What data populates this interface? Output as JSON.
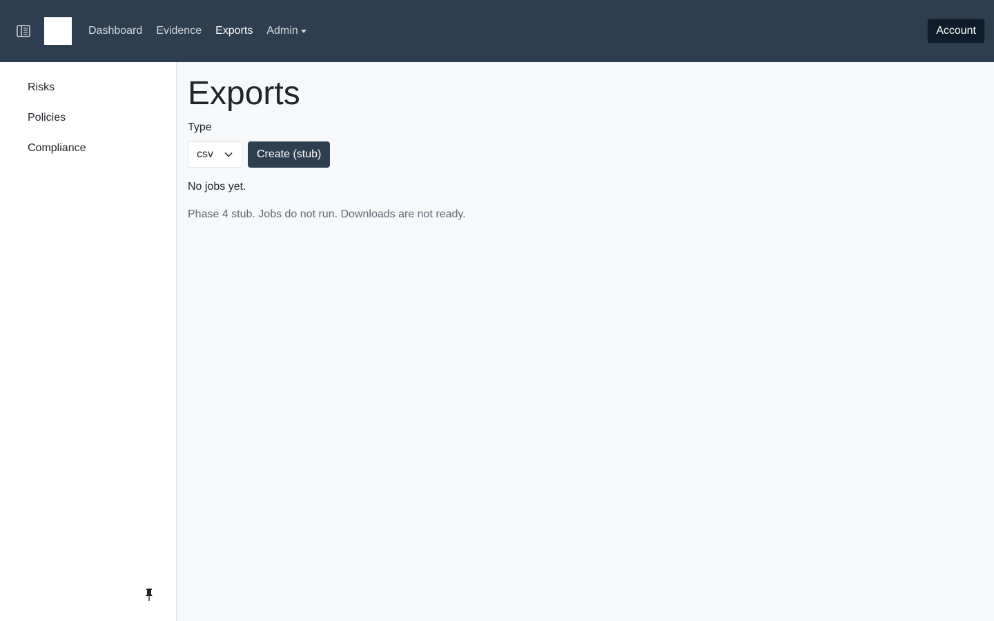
{
  "header": {
    "nav": [
      {
        "label": "Dashboard",
        "active": false
      },
      {
        "label": "Evidence",
        "active": false
      },
      {
        "label": "Exports",
        "active": true
      },
      {
        "label": "Admin",
        "active": false,
        "dropdown": true
      }
    ],
    "account_label": "Account",
    "sidebar_toggle_icon": "sidebar-toggle-icon",
    "background": "#2d3e50"
  },
  "sidebar": {
    "items": [
      {
        "label": "Risks"
      },
      {
        "label": "Policies"
      },
      {
        "label": "Compliance"
      }
    ],
    "pin_icon": "pin-icon"
  },
  "main": {
    "title": "Exports",
    "type_label": "Type",
    "type_select": {
      "value": "csv"
    },
    "create_button_label": "Create (stub)",
    "empty_message": "No jobs yet.",
    "note": "Phase 4 stub. Jobs do not run. Downloads are not ready."
  }
}
